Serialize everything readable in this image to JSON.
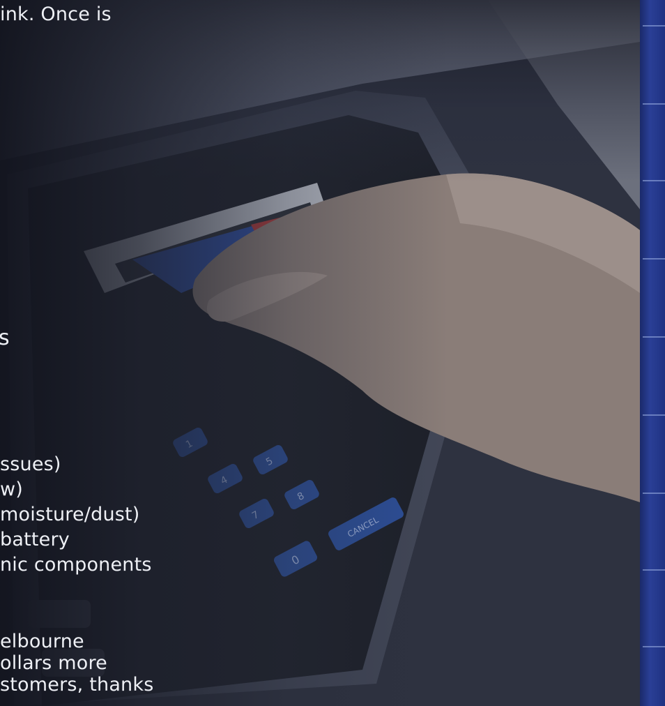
{
  "background_photo": {
    "subject": "atm-card-insertion-photo",
    "keypad_labels": [
      "1",
      "4",
      "5",
      "7",
      "8",
      "0",
      "CANCEL"
    ]
  },
  "intro_fragment": "ink. Once is",
  "heading_fragment": "s",
  "list_fragments": [
    "ssues)",
    "w)",
    "moisture/dust)",
    " battery",
    "nic components"
  ],
  "paragraph_fragments": [
    "elbourne",
    "ollars more",
    "stomers, thanks"
  ],
  "colors": {
    "text": "#eef0f5",
    "edge_strip": "#2a3f96",
    "keypad_button": "#2c4f9a"
  }
}
